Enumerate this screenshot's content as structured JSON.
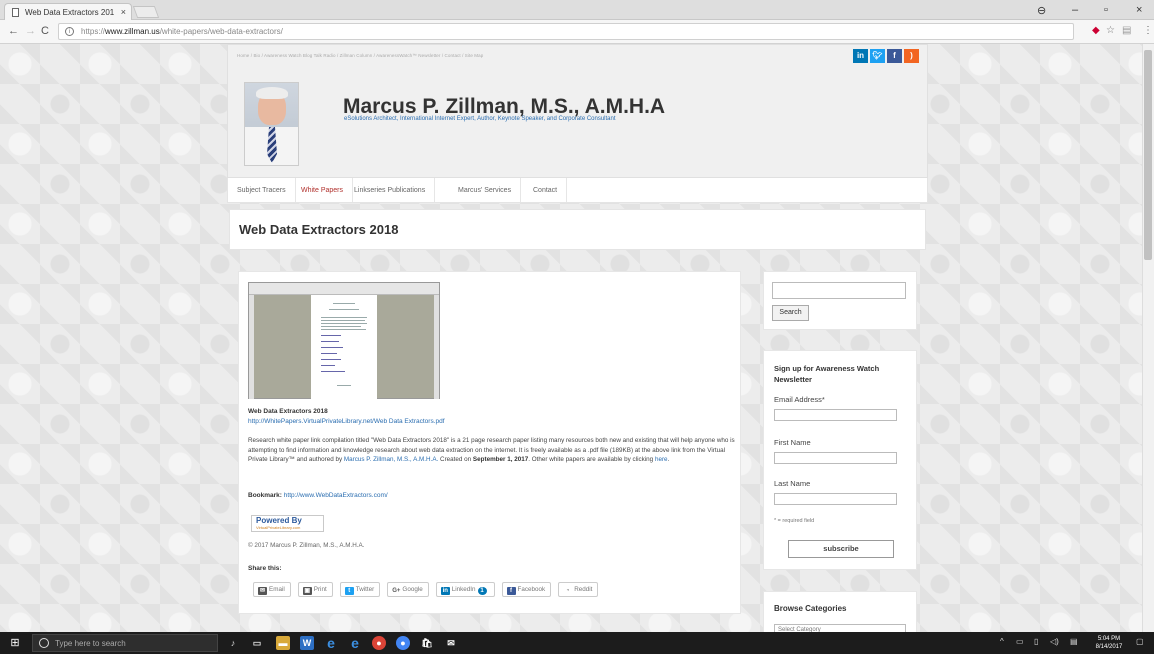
{
  "browser": {
    "tab_title": "Web Data Extractors 201",
    "url_protocol": "https://",
    "url_host": "www.zillman.us",
    "url_path": "/white-papers/web-data-extractors/"
  },
  "site": {
    "top_nav": "Home / Bio / Awareness Watch Blog Talk Radio / Zillman Column / AwarenessWatch™ Newsletter / Contact / Site Map",
    "title": "Marcus P. Zillman, M.S., A.M.H.A",
    "tagline": "eSolutions Architect, International Internet Expert, Author, Keynote Speaker, and Corporate Consultant",
    "social": [
      "in",
      "t",
      "f",
      "rss"
    ],
    "main_nav": [
      "Subject Tracers",
      "White Papers",
      "Linkseries Publications",
      "Marcus' Services",
      "Contact"
    ]
  },
  "page": {
    "title": "Web Data Extractors 2018"
  },
  "content": {
    "doc_title": "Web Data Extractors 2018",
    "doc_url": "http://WhitePapers.VirtualPrivateLibrary.net/Web Data Extractors.pdf",
    "para_1": "Research white paper link compilation titled \"Web Data Extractors 2018\" is a 21 page research paper listing many resources both new and existing that will help anyone who is attempting to find information and knowledge research about web data extraction on the internet. It is freely available as a .pdf file (189KB) at the above link from the Virtual Private Library™ and authored by ",
    "author_link": "Marcus P. Zillman, M.S., A.M.H.A.",
    "para_2": " Created on ",
    "created_date": "September 1, 2017",
    "para_3": ". Other white papers are available by clicking ",
    "here_link": "here",
    "para_4": ".",
    "bookmark_label": "Bookmark:",
    "bookmark_url": "http://www.WebDataExtractors.com/",
    "powered_line1": "Powered By",
    "powered_line2": "VirtualPrivateLibrary.com",
    "copyright": "© 2017 Marcus P. Zillman, M.S., A.M.H.A.",
    "share_label": "Share this:",
    "share_buttons": [
      "Email",
      "Print",
      "Twitter",
      "Google",
      "LinkedIn",
      "Facebook",
      "Reddit"
    ]
  },
  "sidebar": {
    "search_button": "Search",
    "newsletter_heading": "Sign up for Awareness Watch Newsletter",
    "email_label": "Email Address*",
    "first_name_label": "First Name",
    "last_name_label": "Last Name",
    "required_note": "* = required field",
    "subscribe_button": "subscribe",
    "categories_heading": "Browse Categories",
    "categories_select": "Select Category"
  },
  "taskbar": {
    "search_placeholder": "Type here to search",
    "time": "5:04 PM",
    "date": "8/14/2017"
  },
  "colors": {
    "link": "#2a6db0",
    "active_nav": "#b0302c",
    "linkedin": "#0077b5",
    "twitter": "#1da1f2",
    "facebook": "#3b5998",
    "rss": "#f26522"
  }
}
